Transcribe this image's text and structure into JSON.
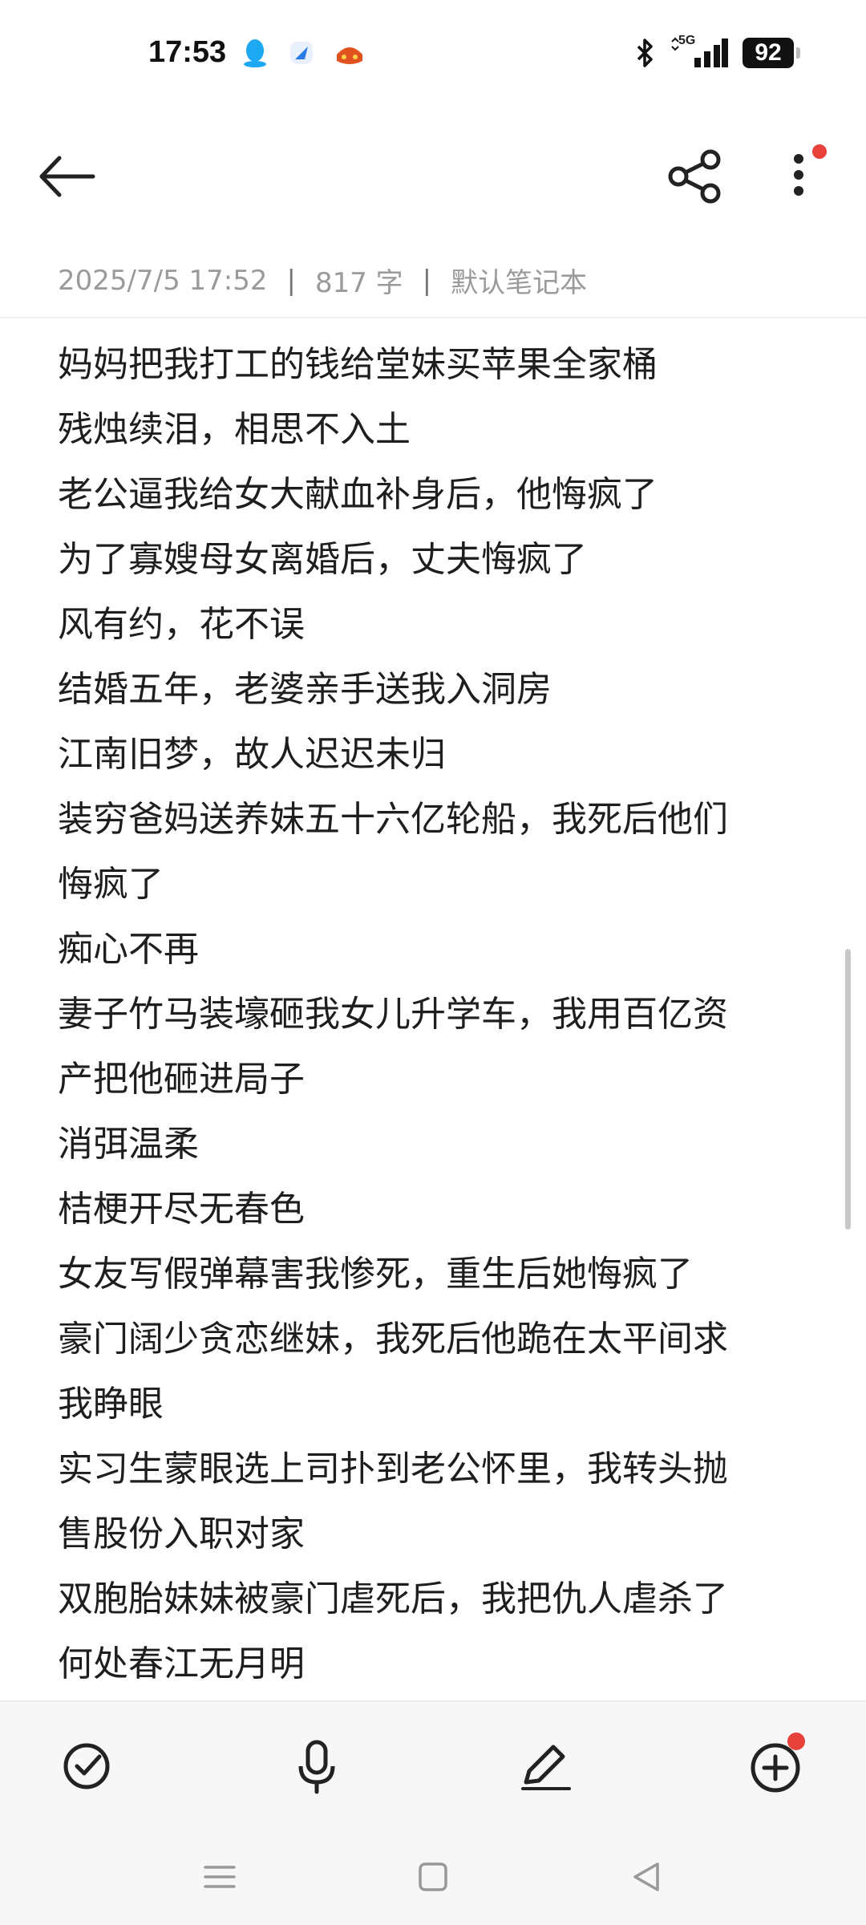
{
  "status_bar": {
    "time": "17:53",
    "battery": "92",
    "network": "5G",
    "notification_icons": [
      "qq-icon",
      "app-icon",
      "game-icon"
    ]
  },
  "header": {
    "back_icon": "back-arrow-icon",
    "share_icon": "share-icon",
    "more_icon": "more-vertical-icon"
  },
  "meta": {
    "datetime": "2025/7/5 17:52",
    "word_count": "817 字",
    "notebook": "默认笔记本",
    "separator": "|"
  },
  "note_lines": [
    "妈妈把我打工的钱给堂妹买苹果全家桶",
    "残烛续泪，相思不入土",
    "老公逼我给女大献血补身后，他悔疯了",
    "为了寡嫂母女离婚后，丈夫悔疯了",
    "风有约，花不误",
    "结婚五年，老婆亲手送我入洞房",
    "江南旧梦，故人迟迟未归",
    "装穷爸妈送养妹五十六亿轮船，我死后他们",
    "悔疯了",
    "痴心不再",
    "妻子竹马装壕砸我女儿升学车，我用百亿资",
    "产把他砸进局子",
    "消弭温柔",
    "桔梗开尽无春色",
    "女友写假弹幕害我惨死，重生后她悔疯了",
    "豪门阔少贪恋继妹，我死后他跪在太平间求",
    "我睁眼",
    "实习生蒙眼选上司扑到老公怀里，我转头抛",
    "售股份入职对家",
    "双胞胎妹妹被豪门虐死后，我把仇人虐杀了",
    "何处春江无月明"
  ],
  "toolbar": {
    "items": [
      "checklist-icon",
      "microphone-icon",
      "pen-icon",
      "add-icon"
    ]
  },
  "colors": {
    "accent_dot": "#e8413a",
    "meta_text": "#9a9a9a",
    "body_text": "#1e1e1e"
  }
}
